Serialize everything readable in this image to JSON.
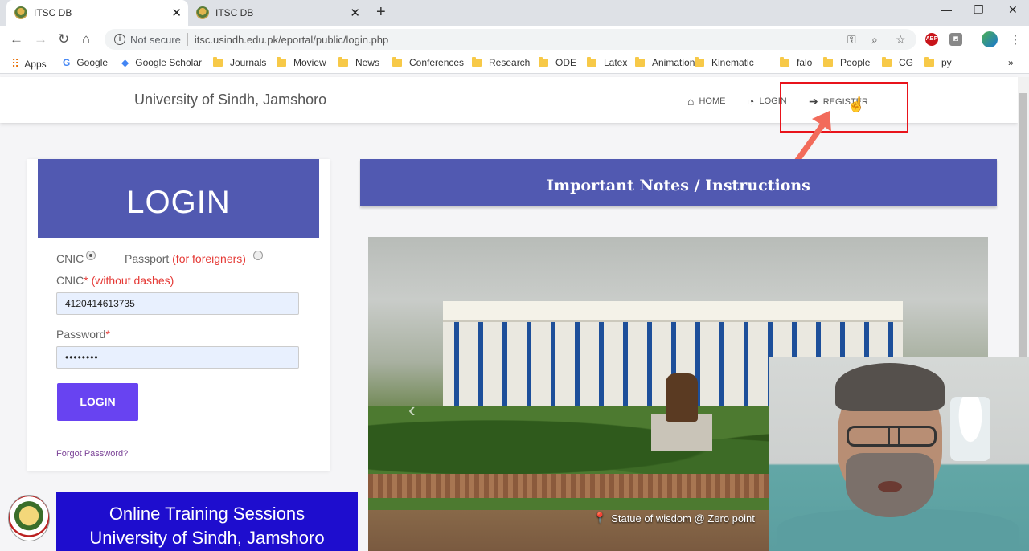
{
  "browser": {
    "tabs": [
      {
        "title": "ITSC DB",
        "active": true
      },
      {
        "title": "ITSC DB",
        "active": false
      }
    ],
    "security_label": "Not secure",
    "url": "itsc.usindh.edu.pk/eportal/public/login.php",
    "bookmarks": [
      {
        "label": "Apps",
        "icon": "apps-grid-icon"
      },
      {
        "label": "Google",
        "icon": "google-icon"
      },
      {
        "label": "Google Scholar",
        "icon": "scholar-icon"
      },
      {
        "label": "Journals",
        "icon": "folder-icon"
      },
      {
        "label": "Moview",
        "icon": "folder-icon"
      },
      {
        "label": "News",
        "icon": "folder-icon"
      },
      {
        "label": "Conferences",
        "icon": "folder-icon"
      },
      {
        "label": "Research",
        "icon": "folder-icon"
      },
      {
        "label": "ODE",
        "icon": "folder-icon"
      },
      {
        "label": "Latex",
        "icon": "folder-icon"
      },
      {
        "label": "Animation",
        "icon": "folder-icon"
      },
      {
        "label": "Kinematic",
        "icon": "folder-icon"
      },
      {
        "label": "falo",
        "icon": "folder-icon"
      },
      {
        "label": "People",
        "icon": "folder-icon"
      },
      {
        "label": "CG",
        "icon": "folder-icon"
      },
      {
        "label": "py",
        "icon": "folder-icon"
      }
    ]
  },
  "site": {
    "brand": "University of Sindh, Jamshoro",
    "nav": {
      "home": "HOME",
      "login": "LOGIN",
      "register": "REGISTER"
    }
  },
  "login": {
    "heading": "LOGIN",
    "radio_cnic": "CNIC",
    "radio_passport": "Passport",
    "radio_passport_note": "(for foreigners)",
    "cnic_label": "CNIC",
    "cnic_required": "*",
    "cnic_note": "(without dashes)",
    "cnic_value": "4120414613735",
    "password_label": "Password",
    "password_required": "*",
    "password_value": "••••••••",
    "submit_label": "LOGIN",
    "forgot_label": "Forgot Password?"
  },
  "training": {
    "line1": "Online Training Sessions",
    "line2": "University of Sindh, Jamshoro"
  },
  "notes": {
    "heading": "Important Notes / Instructions",
    "carousel_caption": "Statue of wisdom @ Zero point"
  },
  "colors": {
    "brand_indigo": "#5159b1",
    "login_button": "#6843f1",
    "training_blue": "#1e0dce",
    "highlight_red": "#e8131b",
    "annotation_arrow": "#f26b5b"
  }
}
